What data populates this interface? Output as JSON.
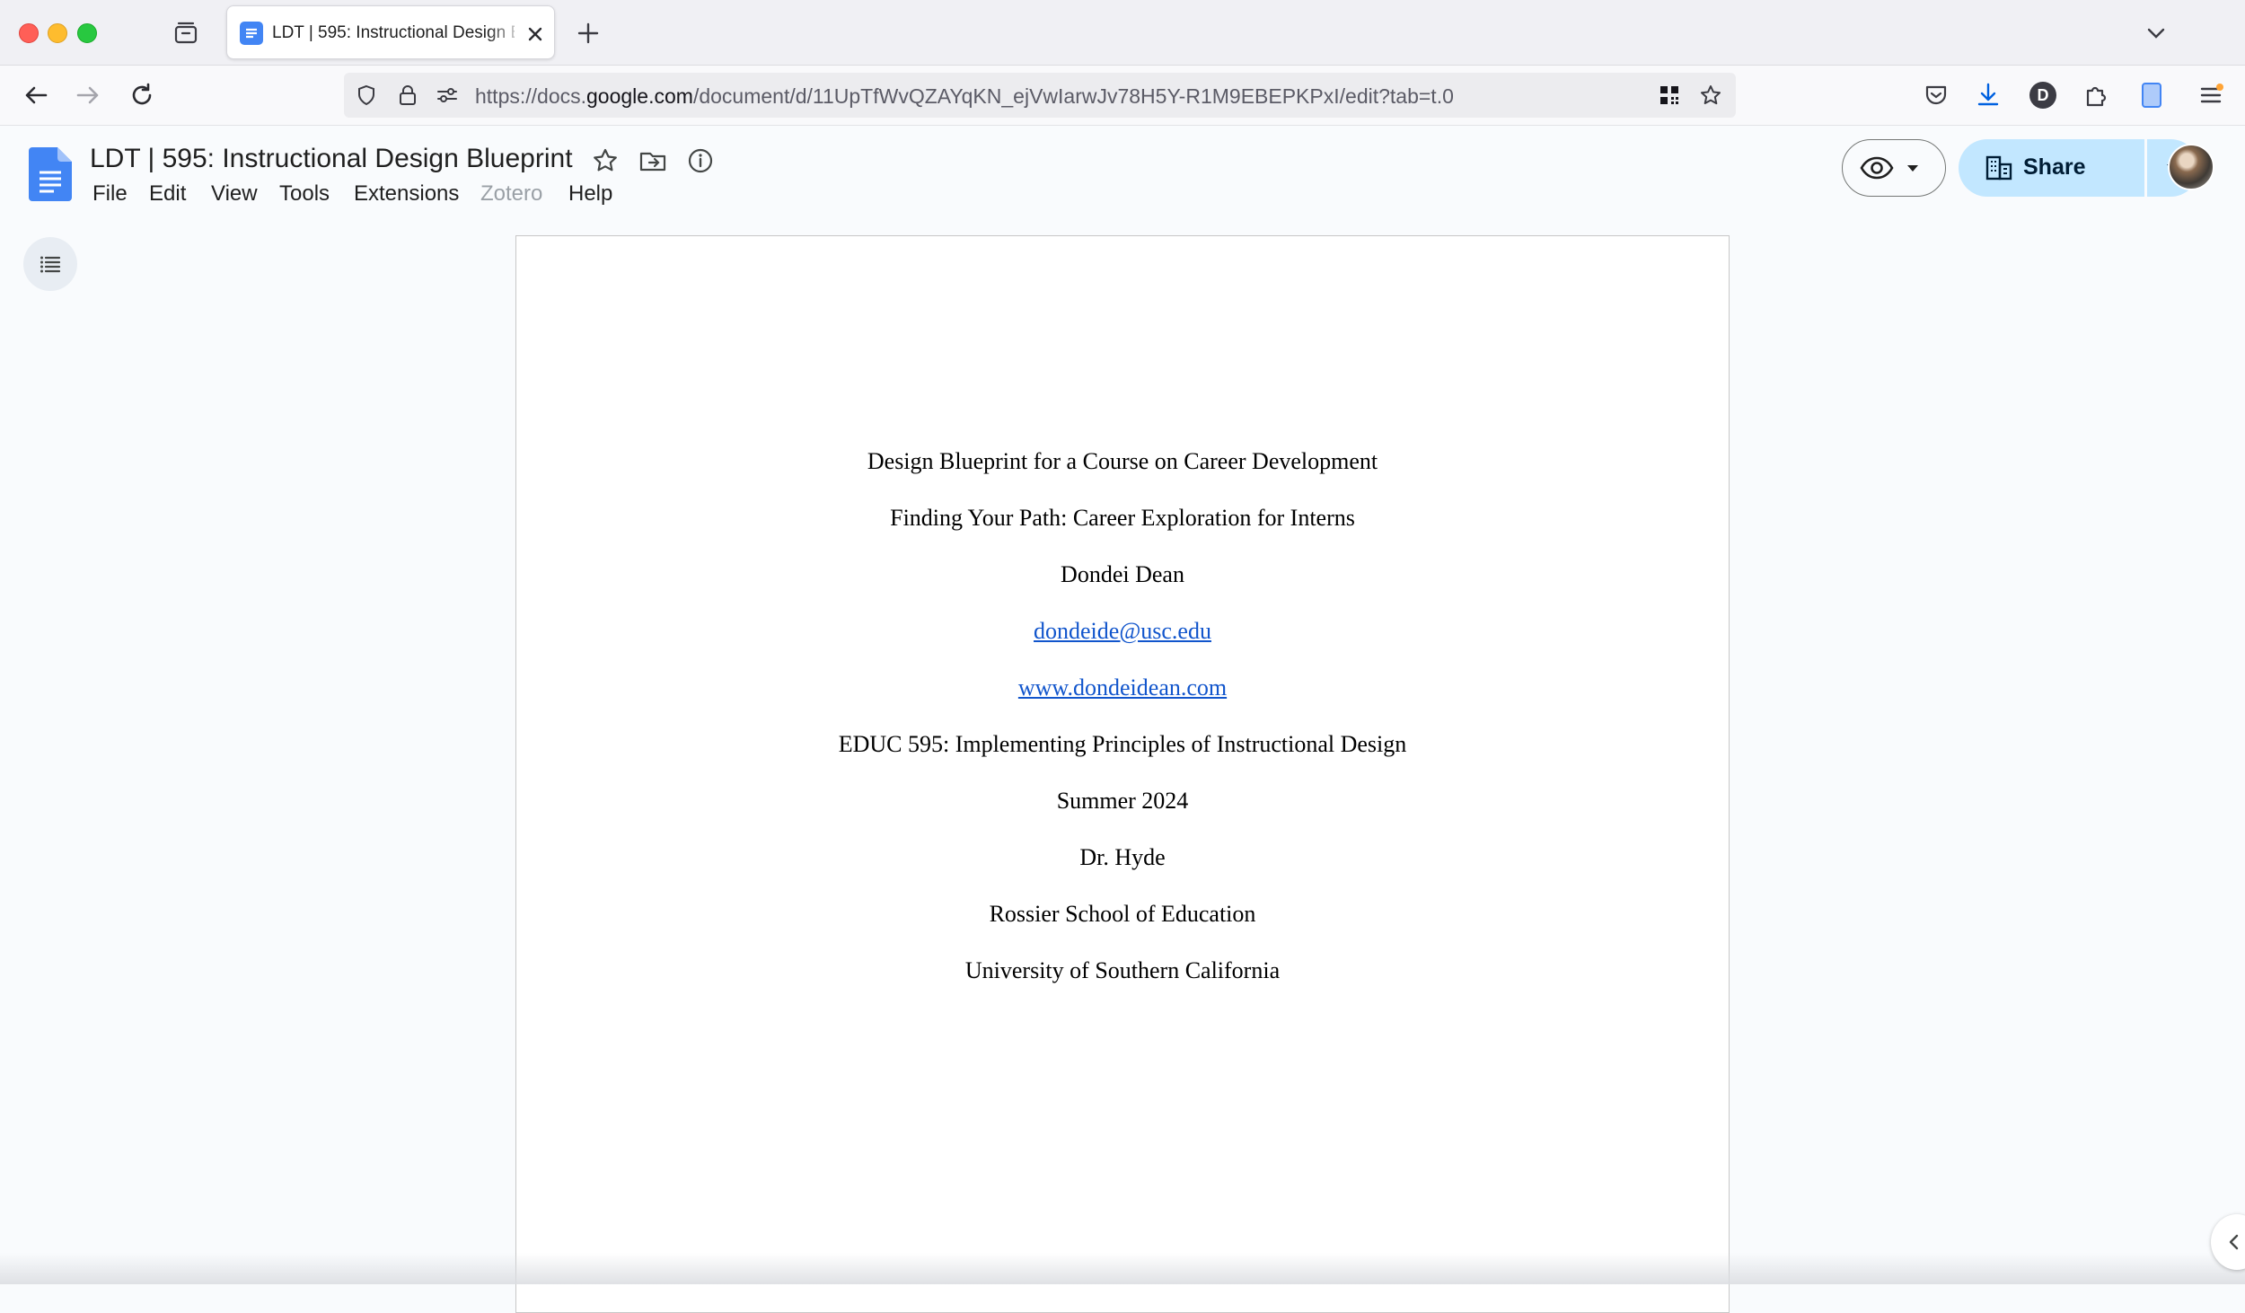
{
  "browser": {
    "tab": {
      "title": "LDT | 595: Instructional Design Blueprint"
    },
    "url": {
      "prefix": "https://docs.",
      "host": "google.com",
      "path": "/document/d/11UpTfWvQZAYqKN_ejVwIarwJv78H5Y-R1M9EBEPKPxI/edit?tab=t.0"
    },
    "profile_initial": "D"
  },
  "docs": {
    "title": "LDT | 595: Instructional Design Blueprint",
    "menu": [
      "File",
      "Edit",
      "View",
      "Tools",
      "Extensions",
      "Zotero",
      "Help"
    ],
    "share_label": "Share"
  },
  "document": {
    "lines": [
      {
        "text": "Design Blueprint for a Course on Career Development",
        "link": false
      },
      {
        "text": "Finding Your Path: Career Exploration for Interns",
        "link": false
      },
      {
        "text": "Dondei Dean",
        "link": false
      },
      {
        "text": "dondeide@usc.edu",
        "link": true
      },
      {
        "text": "www.dondeidean.com",
        "link": true
      },
      {
        "text": "EDUC 595: Implementing Principles of Instructional Design",
        "link": false
      },
      {
        "text": "Summer 2024",
        "link": false
      },
      {
        "text": "Dr. Hyde",
        "link": false
      },
      {
        "text": "Rossier School of Education",
        "link": false
      },
      {
        "text": "University of Southern California",
        "link": false
      }
    ]
  },
  "icons": {
    "tab_overview": "tab-overview-icon",
    "back": "back-arrow-icon",
    "forward": "forward-arrow-icon",
    "reload": "reload-icon",
    "shield": "tracking-shield-icon",
    "lock": "lock-icon",
    "permissions": "permissions-icon",
    "qr": "qr-code-icon",
    "bookmark": "bookmark-star-icon",
    "pocket": "pocket-icon",
    "download": "download-icon",
    "extensions": "extensions-puzzle-icon",
    "docs_ext": "docs-extension-icon",
    "app_menu": "app-menu-icon"
  },
  "colors": {
    "share_bg": "#c2e7ff",
    "link": "#1155cc",
    "docs_blue": "#4285f4"
  }
}
